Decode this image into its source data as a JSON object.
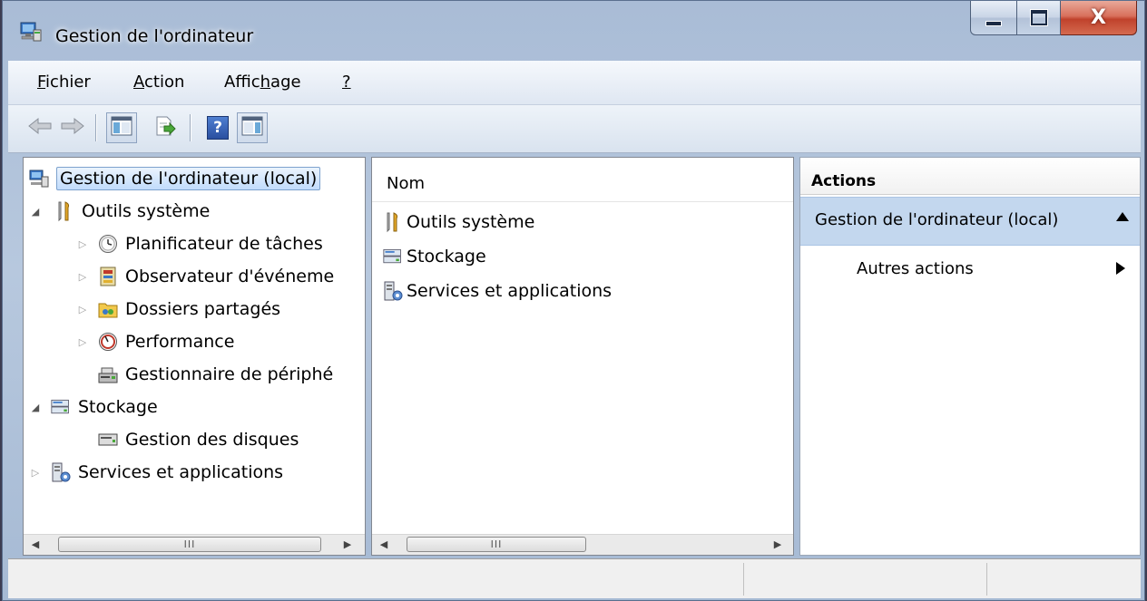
{
  "window": {
    "title": "Gestion de l'ordinateur",
    "close_glyph": "X"
  },
  "menu": [
    {
      "pre": "",
      "ul": "F",
      "post": "ichier"
    },
    {
      "pre": "",
      "ul": "A",
      "post": "ction"
    },
    {
      "pre": "Affic",
      "ul": "h",
      "post": "age"
    },
    {
      "pre": "",
      "ul": "?",
      "post": ""
    }
  ],
  "toolbar": {
    "buttons": [
      "back-icon",
      "forward-icon",
      "show-hide-console-tree-icon",
      "export-list-icon",
      "help-icon",
      "show-hide-action-pane-icon"
    ],
    "help_glyph": "?"
  },
  "tree": {
    "root": "Gestion de l'ordinateur (local)",
    "system_tools": "Outils système",
    "task_scheduler": "Planificateur de tâches",
    "event_viewer": "Observateur d'événeme",
    "shared_folders": "Dossiers partagés",
    "performance": "Performance",
    "device_manager": "Gestionnaire de périphé",
    "storage": "Stockage",
    "disk_management": "Gestion des disques",
    "services": "Services et applications"
  },
  "list": {
    "column_header": "Nom",
    "items": [
      "Outils système",
      "Stockage",
      "Services et applications"
    ]
  },
  "actions": {
    "header": "Actions",
    "group": "Gestion de l'ordinateur (local)",
    "more": "Autres actions"
  },
  "scrollbar": {
    "thumb_grip": "III"
  },
  "colors": {
    "selection_bg": "#c1dcfc",
    "actions_group_bg": "#c3d7ee",
    "frame": "#b7c8de"
  }
}
